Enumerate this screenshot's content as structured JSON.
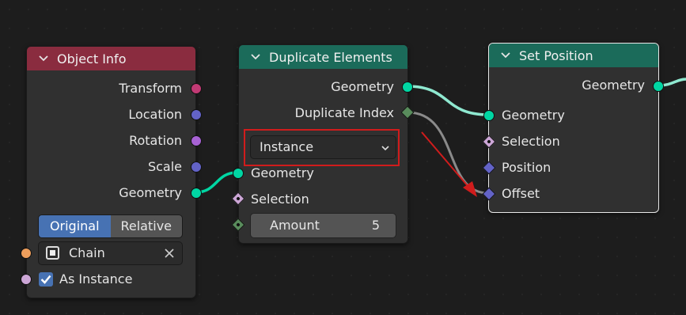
{
  "colors": {
    "geometry_socket": "#00d6a3",
    "transform_socket": "#c13a74",
    "vector_socket": "#6363c7",
    "rotation_socket": "#a762d4",
    "object_socket": "#ed9e5c",
    "boolean_socket": "#cca6d6",
    "integer_socket": "#598c5c",
    "header_input": "#8a2c3f",
    "header_geometry": "#1b6b5a",
    "annotation": "#d01c1c",
    "active_button": "#4772b3"
  },
  "object_info": {
    "title": "Object Info",
    "outputs": [
      "Transform",
      "Location",
      "Rotation",
      "Scale",
      "Geometry"
    ],
    "toggle": {
      "options": [
        "Original",
        "Relative"
      ],
      "selected": "Original"
    },
    "object_field": {
      "value": "Chain"
    },
    "as_instance": {
      "label": "As Instance",
      "checked": true
    }
  },
  "duplicate_elements": {
    "title": "Duplicate Elements",
    "outputs": [
      "Geometry",
      "Duplicate Index"
    ],
    "domain_dropdown": {
      "value": "Instance"
    },
    "inputs": [
      "Geometry",
      "Selection"
    ],
    "amount": {
      "label": "Amount",
      "value": "5"
    }
  },
  "set_position": {
    "title": "Set Position",
    "outputs": [
      "Geometry"
    ],
    "inputs": [
      "Geometry",
      "Selection",
      "Position",
      "Offset"
    ]
  }
}
